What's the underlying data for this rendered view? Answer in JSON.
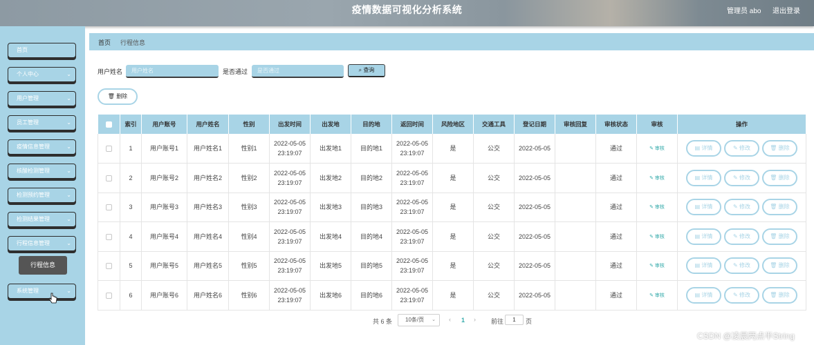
{
  "header": {
    "title": "疫情数据可视化分析系统",
    "user": "管理员 abo",
    "logout": "退出登录"
  },
  "sidebar": {
    "items": [
      {
        "label": "首页",
        "chevron": false
      },
      {
        "label": "个人中心",
        "chevron": true
      },
      {
        "label": "用户管理",
        "chevron": true
      },
      {
        "label": "员工管理",
        "chevron": true
      },
      {
        "label": "疫情信息管理",
        "chevron": true
      },
      {
        "label": "核酸检测管理",
        "chevron": true
      },
      {
        "label": "检测预约管理",
        "chevron": true
      },
      {
        "label": "检测结果管理",
        "chevron": true
      },
      {
        "label": "行程信息管理",
        "chevron": true
      },
      {
        "label": "系统管理",
        "chevron": true
      }
    ],
    "submenu": "行程信息"
  },
  "breadcrumb": {
    "home": "首页",
    "current": "行程信息"
  },
  "search": {
    "username_label": "用户姓名",
    "username_placeholder": "用户姓名",
    "passed_label": "是否通过",
    "passed_placeholder": "是否通过",
    "button": "查询"
  },
  "delete_button": "删除",
  "table": {
    "headers": [
      "索引",
      "用户账号",
      "用户姓名",
      "性别",
      "出发时间",
      "出发地",
      "目的地",
      "返回时间",
      "风险地区",
      "交通工具",
      "登记日期",
      "审核回复",
      "审核状态",
      "审核",
      "操作"
    ],
    "rows": [
      {
        "index": "1",
        "account": "用户账号1",
        "name": "用户姓名1",
        "gender": "性别1",
        "depart_time": "2022-05-05 23:19:07",
        "from": "出发地1",
        "to": "目的地1",
        "return_time": "2022-05-05 23:19:07",
        "risk": "是",
        "vehicle": "公交",
        "reg_date": "2022-05-05",
        "reply": "",
        "status": "通过",
        "audit": "审核"
      },
      {
        "index": "2",
        "account": "用户账号2",
        "name": "用户姓名2",
        "gender": "性别2",
        "depart_time": "2022-05-05 23:19:07",
        "from": "出发地2",
        "to": "目的地2",
        "return_time": "2022-05-05 23:19:07",
        "risk": "是",
        "vehicle": "公交",
        "reg_date": "2022-05-05",
        "reply": "",
        "status": "通过",
        "audit": "审核"
      },
      {
        "index": "3",
        "account": "用户账号3",
        "name": "用户姓名3",
        "gender": "性别3",
        "depart_time": "2022-05-05 23:19:07",
        "from": "出发地3",
        "to": "目的地3",
        "return_time": "2022-05-05 23:19:07",
        "risk": "是",
        "vehicle": "公交",
        "reg_date": "2022-05-05",
        "reply": "",
        "status": "通过",
        "audit": "审核"
      },
      {
        "index": "4",
        "account": "用户账号4",
        "name": "用户姓名4",
        "gender": "性别4",
        "depart_time": "2022-05-05 23:19:07",
        "from": "出发地4",
        "to": "目的地4",
        "return_time": "2022-05-05 23:19:07",
        "risk": "是",
        "vehicle": "公交",
        "reg_date": "2022-05-05",
        "reply": "",
        "status": "通过",
        "audit": "审核"
      },
      {
        "index": "5",
        "account": "用户账号5",
        "name": "用户姓名5",
        "gender": "性别5",
        "depart_time": "2022-05-05 23:19:07",
        "from": "出发地5",
        "to": "目的地5",
        "return_time": "2022-05-05 23:19:07",
        "risk": "是",
        "vehicle": "公交",
        "reg_date": "2022-05-05",
        "reply": "",
        "status": "通过",
        "audit": "审核"
      },
      {
        "index": "6",
        "account": "用户账号6",
        "name": "用户姓名6",
        "gender": "性别6",
        "depart_time": "2022-05-05 23:19:07",
        "from": "出发地6",
        "to": "目的地6",
        "return_time": "2022-05-05 23:19:07",
        "risk": "是",
        "vehicle": "公交",
        "reg_date": "2022-05-05",
        "reply": "",
        "status": "通过",
        "audit": "审核"
      }
    ],
    "actions": {
      "detail": "详情",
      "edit": "修改",
      "delete": "删除"
    }
  },
  "pagination": {
    "total": "共 6 条",
    "page_size": "10条/页",
    "current": "1",
    "goto_label": "前往",
    "goto_value": "1",
    "page_suffix": "页"
  },
  "watermark": "CSDN @凌晨两点半String",
  "colors": {
    "accent": "#a8d4e6",
    "link": "#33aaaa"
  }
}
